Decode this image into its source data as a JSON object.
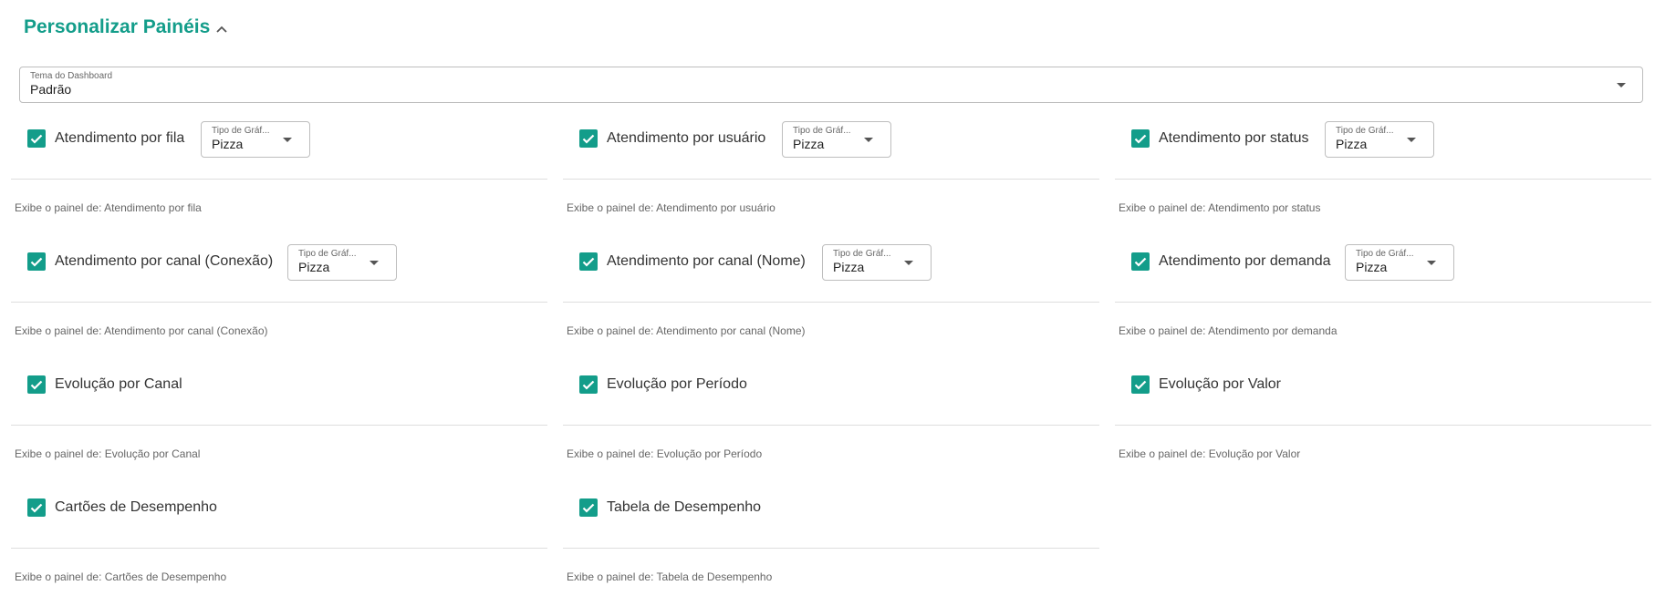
{
  "section": {
    "title": "Personalizar Painéis",
    "toggle_icon": "chevron-up-icon"
  },
  "theme": {
    "label": "Tema do Dashboard",
    "value": "Padrão"
  },
  "accent_color": "#139d8a",
  "panels": [
    {
      "title": "Atendimento por fila",
      "checked": true,
      "chart_type": {
        "label": "Tipo de Gráf...",
        "value": "Pizza"
      },
      "description": "Exibe o painel de: Atendimento por fila"
    },
    {
      "title": "Atendimento por usuário",
      "checked": true,
      "chart_type": {
        "label": "Tipo de Gráf...",
        "value": "Pizza"
      },
      "description": "Exibe o painel de: Atendimento por usuário"
    },
    {
      "title": "Atendimento por status",
      "checked": true,
      "chart_type": {
        "label": "Tipo de Gráf...",
        "value": "Pizza"
      },
      "description": "Exibe o painel de: Atendimento por status"
    },
    {
      "title": "Atendimento por canal (Conexão)",
      "checked": true,
      "chart_type": {
        "label": "Tipo de Gráf...",
        "value": "Pizza"
      },
      "description": "Exibe o painel de: Atendimento por canal (Conexão)"
    },
    {
      "title": "Atendimento por canal (Nome)",
      "checked": true,
      "chart_type": {
        "label": "Tipo de Gráf...",
        "value": "Pizza"
      },
      "description": "Exibe o painel de: Atendimento por canal (Nome)"
    },
    {
      "title": "Atendimento por demanda",
      "checked": true,
      "chart_type": {
        "label": "Tipo de Gráf...",
        "value": "Pizza"
      },
      "description": "Exibe o painel de: Atendimento por demanda"
    },
    {
      "title": "Evolução por Canal",
      "checked": true,
      "description": "Exibe o painel de: Evolução por Canal"
    },
    {
      "title": "Evolução por Período",
      "checked": true,
      "description": "Exibe o painel de: Evolução por Período"
    },
    {
      "title": "Evolução por Valor",
      "checked": true,
      "description": "Exibe o painel de: Evolução por Valor"
    },
    {
      "title": "Cartões de Desempenho",
      "checked": true,
      "description": "Exibe o painel de: Cartões de Desempenho"
    },
    {
      "title": "Tabela de Desempenho",
      "checked": true,
      "description": "Exibe o painel de: Tabela de Desempenho"
    }
  ]
}
